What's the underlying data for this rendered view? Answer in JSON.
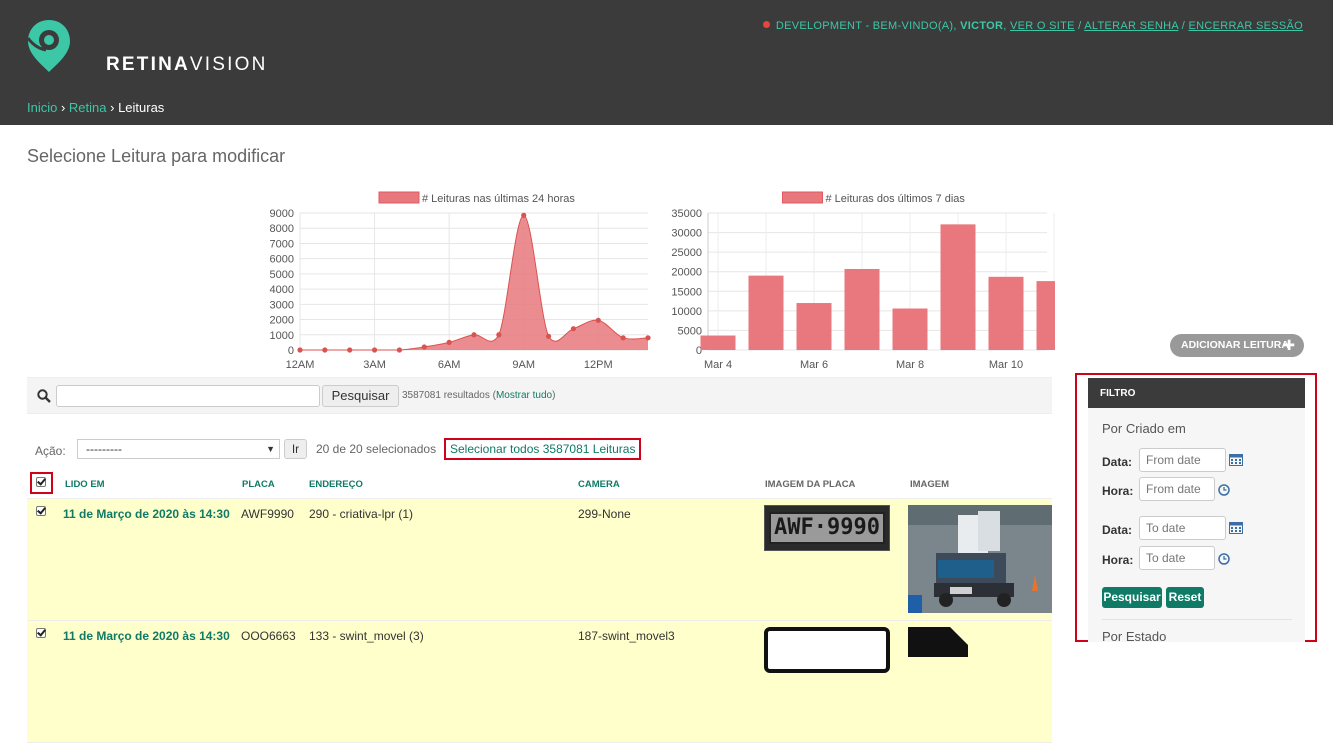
{
  "header": {
    "brand_bold": "RETINA",
    "brand_light": "VISION",
    "env": "DEVELOPMENT",
    "welcome": "BEM-VINDO(A),",
    "user": "VICTOR",
    "links": [
      "VER O SITE",
      "ALTERAR SENHA",
      "ENCERRAR SESSÃO"
    ],
    "env_dot_color": "#e0473f",
    "accent": "#3cc7a6"
  },
  "breadcrumbs": [
    "Inicio",
    "Retina",
    "Leituras"
  ],
  "page": {
    "title": "Selecione Leitura para modificar"
  },
  "add_button": {
    "label": "ADICIONAR LEITURA"
  },
  "search": {
    "placeholder": "",
    "button": "Pesquisar",
    "count_text": "3587081 resultados (",
    "show_all": "Mostrar tudo",
    "count_end": ")"
  },
  "actions": {
    "label": "Ação:",
    "selected_option": "---------",
    "go": "Ir",
    "selected_text": "20 de 20 selecionados",
    "select_all": "Selecionar todos 3587081 Leituras"
  },
  "table": {
    "columns": [
      "LIDO EM",
      "PLACA",
      "ENDEREÇO",
      "CAMERA",
      "IMAGEM DA PLACA",
      "IMAGEM"
    ],
    "rows": [
      {
        "date": "11 de Março de 2020 às 14:30",
        "plate": "AWF9990",
        "address": "290 - criativa-lpr (1)",
        "camera": "299-None",
        "plate_image_text": "AWF·9990"
      },
      {
        "date": "11 de Março de 2020 às 14:30",
        "plate": "OOO6663",
        "address": "133 - swint_movel (3)",
        "camera": "187-swint_movel3",
        "plate_image_text": ""
      }
    ]
  },
  "filter": {
    "title": "FILTRO",
    "section1": "Por Criado em",
    "date_label": "Data:",
    "time_label": "Hora:",
    "from_date": "From date",
    "to_date": "To date",
    "search_btn": "Pesquisar",
    "reset_btn": "Reset",
    "section2": "Por Estado"
  },
  "chart_data": [
    {
      "type": "area",
      "legend": "# Leituras nas últimas 24 horas",
      "color": "#e8787d",
      "x_ticks": [
        "12AM",
        "3AM",
        "6AM",
        "9AM",
        "12PM"
      ],
      "y_ticks": [
        0,
        1000,
        2000,
        3000,
        4000,
        5000,
        6000,
        7000,
        8000,
        9000
      ],
      "ylim": [
        0,
        9000
      ],
      "x": [
        0,
        1,
        2,
        3,
        4,
        5,
        6,
        7,
        8,
        9,
        10,
        11,
        12,
        13,
        14
      ],
      "values": [
        0,
        0,
        0,
        0,
        0,
        200,
        500,
        1000,
        1000,
        8850,
        900,
        1400,
        1950,
        800,
        800
      ],
      "grid": true
    },
    {
      "type": "bar",
      "legend": "# Leituras dos últimos 7 dias",
      "color": "#e8787d",
      "x_ticks": [
        "Mar 4",
        "Mar 6",
        "Mar 8",
        "Mar 10"
      ],
      "y_ticks": [
        0,
        5000,
        10000,
        15000,
        20000,
        25000,
        30000,
        35000
      ],
      "ylim": [
        0,
        35000
      ],
      "categories": [
        "Mar 4",
        "Mar 5",
        "Mar 6",
        "Mar 7",
        "Mar 8",
        "Mar 9",
        "Mar 10",
        "Mar 11"
      ],
      "values": [
        3700,
        19000,
        12000,
        20700,
        10600,
        32100,
        18700,
        17600
      ],
      "grid": true
    }
  ]
}
